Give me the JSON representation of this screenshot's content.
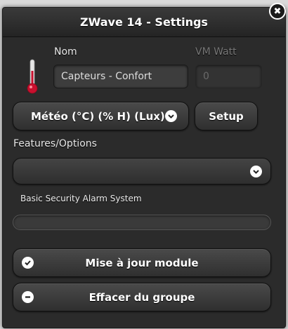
{
  "dialog": {
    "title": "ZWave 14 - Settings",
    "close_label": "✖"
  },
  "form": {
    "name_label": "Nom",
    "name_value": "Capteurs - Confort",
    "vm_watt_label": "VM Watt",
    "vm_watt_placeholder": "0",
    "device_type_label": "Météo (°C) (% H) (Lux)",
    "setup_label": "Setup",
    "features_label": "Features/Options",
    "features_selected": "",
    "security_label": "Basic Security Alarm System",
    "security_progress": 0
  },
  "actions": {
    "update_label": "Mise à jour module",
    "remove_label": "Effacer du groupe"
  },
  "colors": {
    "dialog_bg": "#2b2b2b",
    "thermometer_red": "#c8102e"
  }
}
